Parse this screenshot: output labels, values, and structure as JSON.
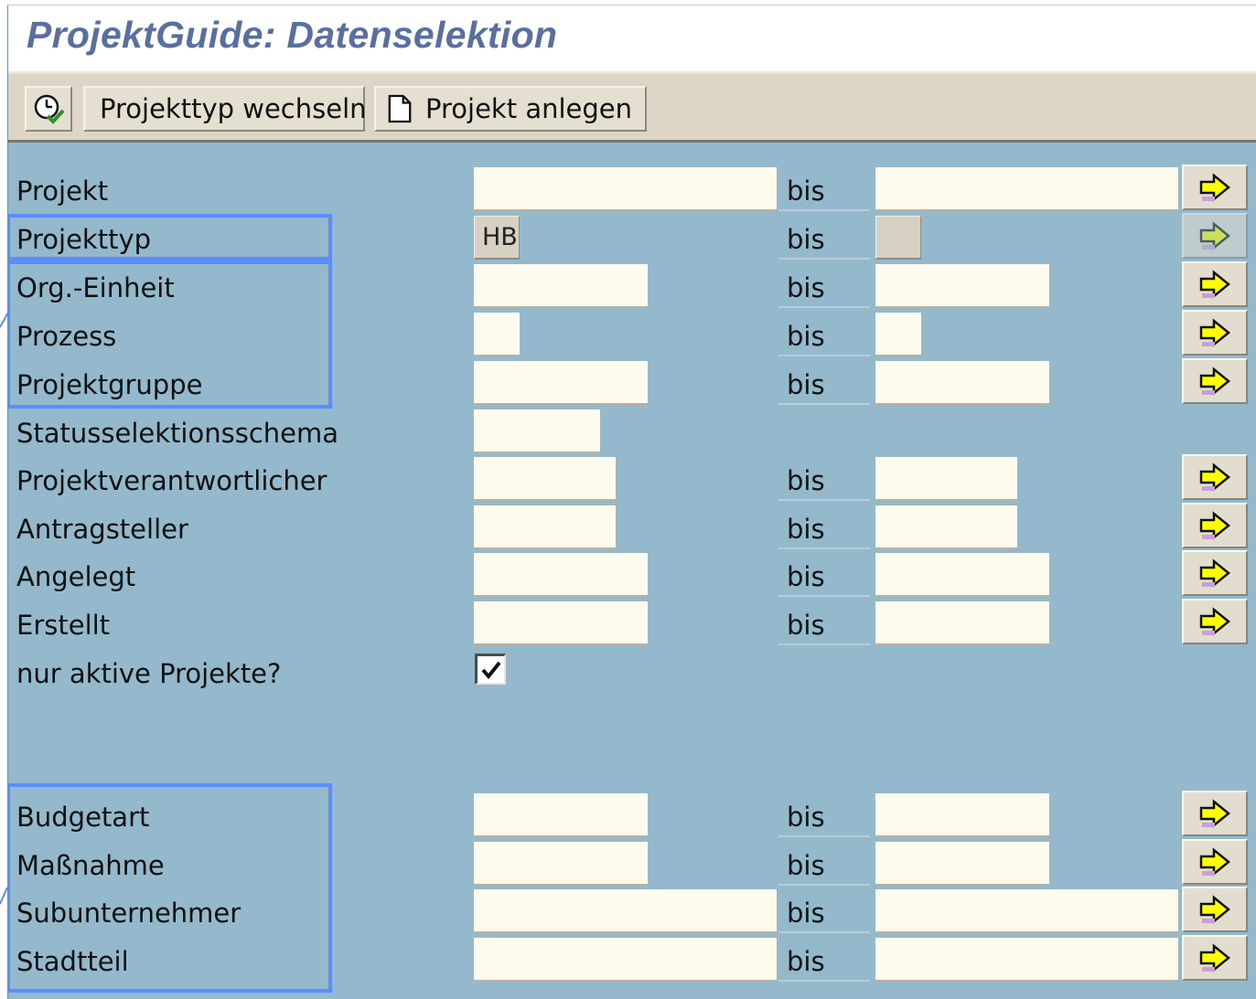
{
  "window": {
    "title": "ProjektGuide: Datenselektion"
  },
  "toolbar": {
    "execute_icon": "execute-clock-icon",
    "type_label": "Projekttyp wechseln",
    "new_label": "Projekt anlegen",
    "new_icon": "document-icon"
  },
  "form": {
    "bis": "bis",
    "fields": [
      {
        "label": "Projekt",
        "from": "",
        "to": ""
      },
      {
        "label": "Projekttyp",
        "from": "HB",
        "to": "",
        "readonly": true
      },
      {
        "label": "Org.-Einheit",
        "from": "",
        "to": ""
      },
      {
        "label": "Prozess",
        "from": "",
        "to": ""
      },
      {
        "label": "Projektgruppe",
        "from": "",
        "to": ""
      },
      {
        "label": "Statusselektionsschema",
        "from": ""
      },
      {
        "label": "Projektverantwortlicher",
        "from": "",
        "to": ""
      },
      {
        "label": "Antragsteller",
        "from": "",
        "to": ""
      },
      {
        "label": "Angelegt",
        "from": "",
        "to": ""
      },
      {
        "label": "Erstellt",
        "from": "",
        "to": ""
      },
      {
        "label": "nur aktive Projekte?",
        "checked": true
      },
      {
        "label": "Budgetart",
        "from": "",
        "to": ""
      },
      {
        "label": "Maßnahme",
        "from": "",
        "to": ""
      },
      {
        "label": "Subunternehmer",
        "from": "",
        "to": ""
      },
      {
        "label": "Stadtteil",
        "from": "",
        "to": ""
      }
    ]
  },
  "icons": {
    "multiple_selection": "yellow-arrow-right-icon",
    "checkbox": "checkmark-icon"
  },
  "colors": {
    "form_background": "#94b8cc",
    "title_text": "#5a6fa0",
    "highlight_box": "#5b8dff",
    "input_background": "#fdfbee",
    "arrow_fill": "#ffff00"
  }
}
